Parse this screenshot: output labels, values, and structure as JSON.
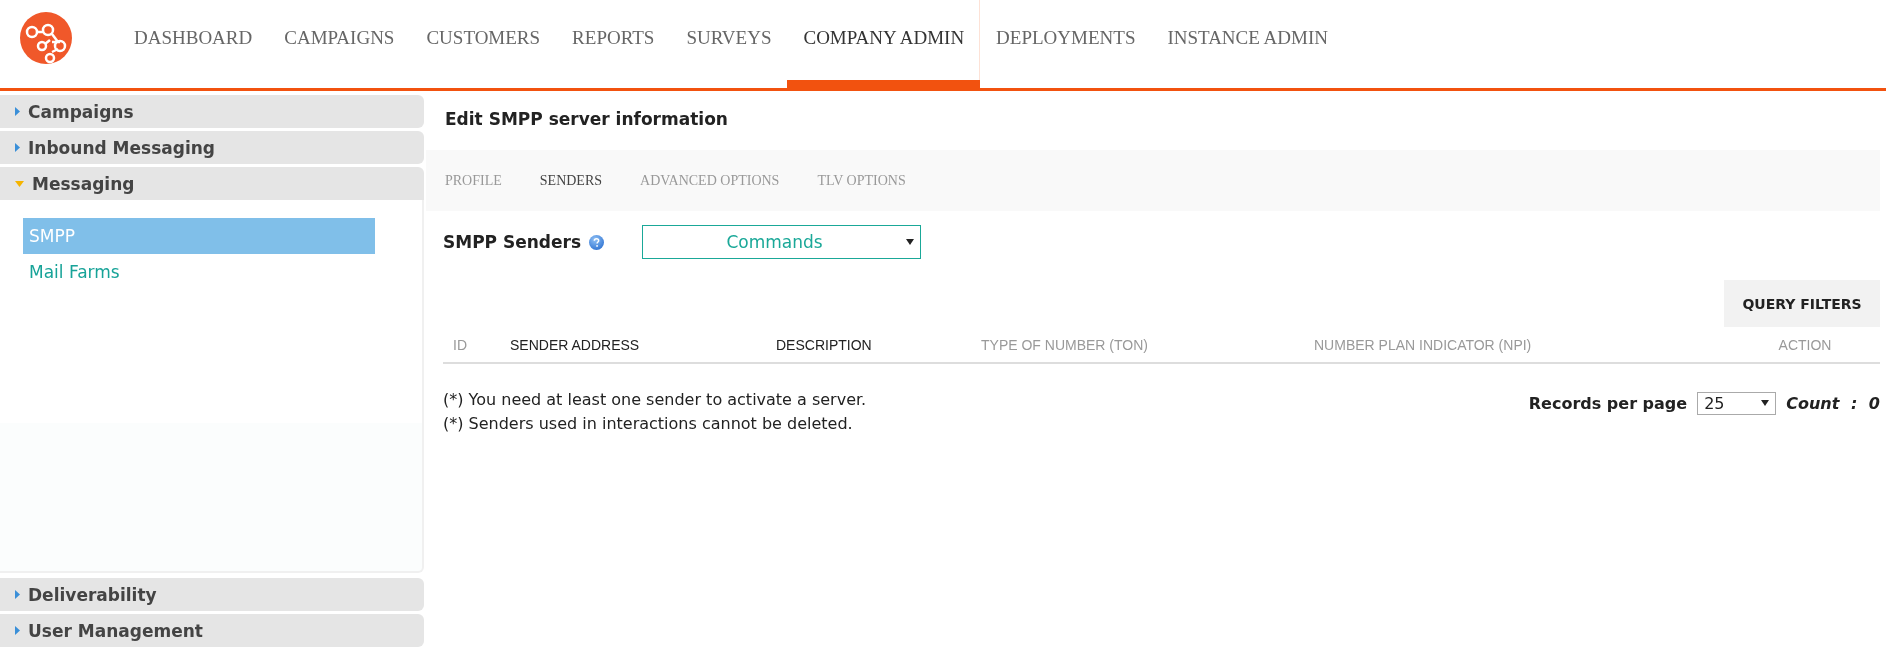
{
  "nav": {
    "items": [
      {
        "label": "DASHBOARD",
        "selected": false
      },
      {
        "label": "CAMPAIGNS",
        "selected": false
      },
      {
        "label": "CUSTOMERS",
        "selected": false
      },
      {
        "label": "REPORTS",
        "selected": false
      },
      {
        "label": "SURVEYS",
        "selected": false
      },
      {
        "label": "COMPANY ADMIN",
        "selected": true
      },
      {
        "label": "DEPLOYMENTS",
        "selected": false
      },
      {
        "label": "INSTANCE ADMIN",
        "selected": false
      }
    ]
  },
  "sidebar": {
    "sections": [
      {
        "label": "Campaigns",
        "expanded": false
      },
      {
        "label": "Inbound Messaging",
        "expanded": false
      },
      {
        "label": "Messaging",
        "expanded": true,
        "children": [
          {
            "label": "SMPP",
            "selected": true
          },
          {
            "label": "Mail Farms",
            "selected": false
          }
        ]
      },
      {
        "label": "Deliverability",
        "expanded": false
      },
      {
        "label": "User Management",
        "expanded": false
      }
    ]
  },
  "page": {
    "title": "Edit SMPP server information",
    "tabs": [
      {
        "label": "PROFILE",
        "selected": false
      },
      {
        "label": "SENDERS",
        "selected": true
      },
      {
        "label": "ADVANCED OPTIONS",
        "selected": false
      },
      {
        "label": "TLV OPTIONS",
        "selected": false
      }
    ],
    "senders_label": "SMPP Senders",
    "commands_select": {
      "value": "Commands"
    },
    "query_filters_button": "QUERY FILTERS",
    "table": {
      "columns": [
        {
          "label": "ID",
          "muted": true
        },
        {
          "label": "SENDER ADDRESS",
          "muted": false
        },
        {
          "label": "DESCRIPTION",
          "muted": false
        },
        {
          "label": "TYPE OF NUMBER (TON)",
          "muted": true
        },
        {
          "label": "NUMBER PLAN INDICATOR (NPI)",
          "muted": true
        },
        {
          "label": "ACTION",
          "muted": true
        }
      ]
    },
    "notes": [
      "(*) You need at least one sender to activate a server.",
      "(*) Senders used in interactions cannot be deleted."
    ],
    "records_per_page": {
      "label": "Records per page",
      "value": "25"
    },
    "count": "Count : 0"
  }
}
